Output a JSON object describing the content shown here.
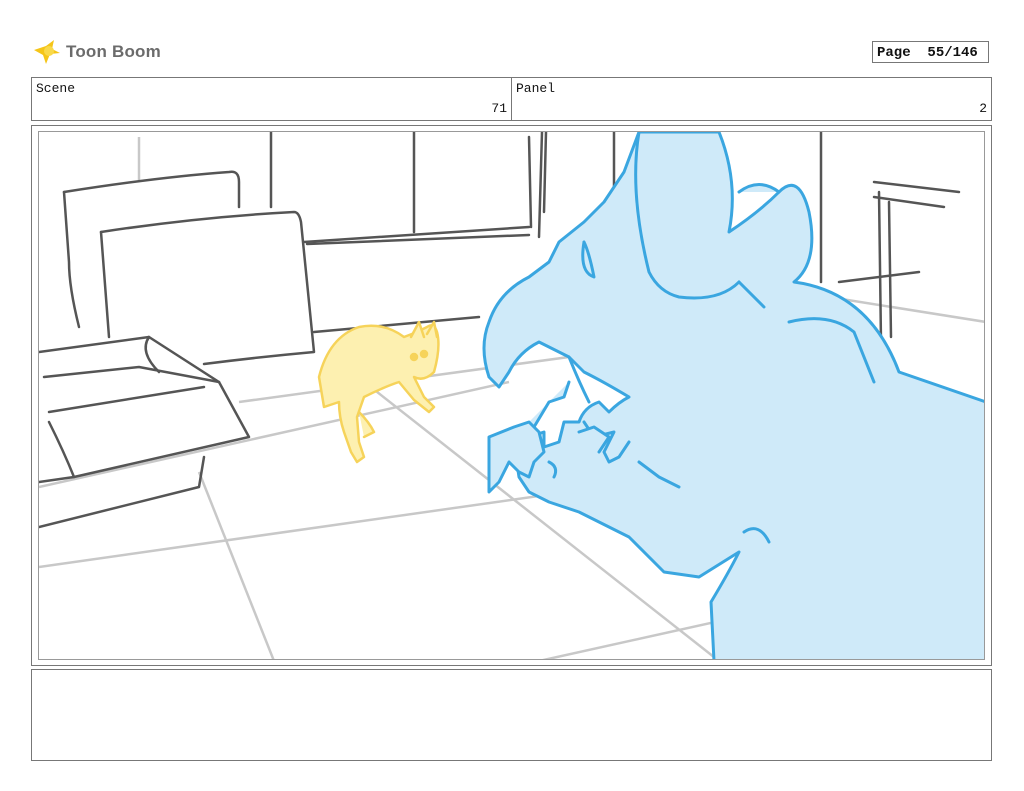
{
  "header": {
    "logo_text": "Toon Boom",
    "page_label": "Page",
    "page_value": "55/146"
  },
  "scene": {
    "label": "Scene",
    "value": "71"
  },
  "panel": {
    "label": "Panel",
    "value": "2"
  },
  "notes": {
    "text": ""
  },
  "colors": {
    "logo_yellow": "#f5c518",
    "cat_yellow": "#f6d35a",
    "cat_fill": "#fdf0b0",
    "creature_blue": "#3aa6e0",
    "creature_fill": "#cfeaf9",
    "sketch_gray": "#555555",
    "floor_gray": "#c8c8c8"
  }
}
